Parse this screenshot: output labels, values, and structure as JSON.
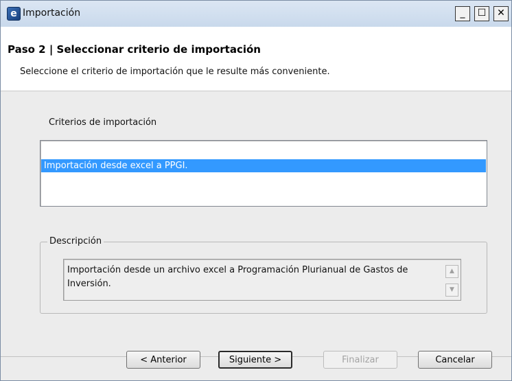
{
  "window": {
    "title": "Importación",
    "controls": {
      "minimize": "_",
      "maximize": "☐",
      "close": "✕"
    }
  },
  "header": {
    "step_title": "Paso 2 | Seleccionar criterio de importación",
    "description": "Seleccione el criterio de importación que le resulte más conveniente."
  },
  "criteria": {
    "label": "Criterios de importación",
    "items": [
      {
        "label": "Importación desde excel a PPGI.",
        "selected": true
      }
    ]
  },
  "description_box": {
    "legend": "Descripción",
    "text": "Importación desde un archivo excel a Programación Plurianual de Gastos de Inversión."
  },
  "buttons": {
    "back": "< Anterior",
    "next": "Siguiente >",
    "finish": "Finalizar",
    "cancel": "Cancelar"
  },
  "colors": {
    "selection": "#3399ff",
    "titlebar": "#c9d9ec"
  },
  "icons": [
    "app-icon",
    "minimize-icon",
    "maximize-icon",
    "close-icon",
    "scroll-up-arrow-icon",
    "scroll-down-arrow-icon"
  ]
}
